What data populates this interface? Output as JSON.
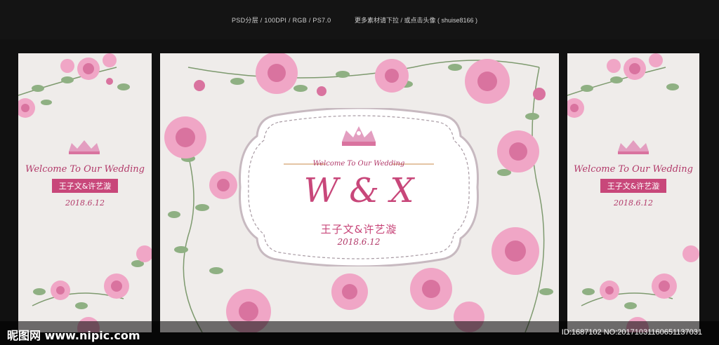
{
  "top_bar": {
    "spec": "PSD分层 / 100DPI / RGB / PS7.0",
    "hint": "更多素材请下拉 / 或点击头像 ( shuise8166 )"
  },
  "left_panel": {
    "welcome": "Welcome To Our Wedding",
    "names": "王子文&许艺漩",
    "date": "2018.6.12"
  },
  "main_panel": {
    "welcome": "Welcome To Our Wedding",
    "monogram": "W & X",
    "names": "王子文&许艺漩",
    "date": "2018.6.12"
  },
  "right_panel": {
    "welcome": "Welcome To Our Wedding",
    "names": "王子文&许艺漩",
    "date": "2018.6.12"
  },
  "watermark": {
    "logo": "昵图网 www.nipic.com",
    "id": "ID:1687102 NO:20171031160651137031"
  },
  "colors": {
    "accent": "#c8477a",
    "rose": "#f0a6c6",
    "rose_dark": "#d9739f",
    "leaf": "#8fb083",
    "panel_bg": "#efecea"
  }
}
